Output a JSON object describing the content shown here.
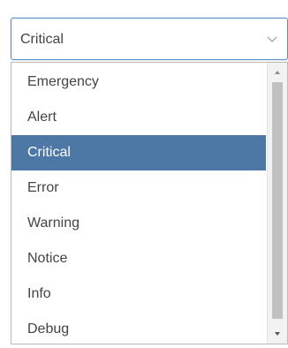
{
  "select": {
    "value": "Critical",
    "chevron_icon": "chevron-down-icon"
  },
  "listbox": {
    "selected_index": 2,
    "options": [
      {
        "label": "Emergency"
      },
      {
        "label": "Alert"
      },
      {
        "label": "Critical"
      },
      {
        "label": "Error"
      },
      {
        "label": "Warning"
      },
      {
        "label": "Notice"
      },
      {
        "label": "Info"
      },
      {
        "label": "Debug"
      }
    ]
  },
  "colors": {
    "selected_bg": "#4d78a6",
    "selected_text": "#ffffff",
    "focus_border": "#5b8fc4",
    "text": "#444444"
  },
  "scrollbar": {
    "up_icon": "arrow-up-icon",
    "down_icon": "arrow-down-icon"
  }
}
